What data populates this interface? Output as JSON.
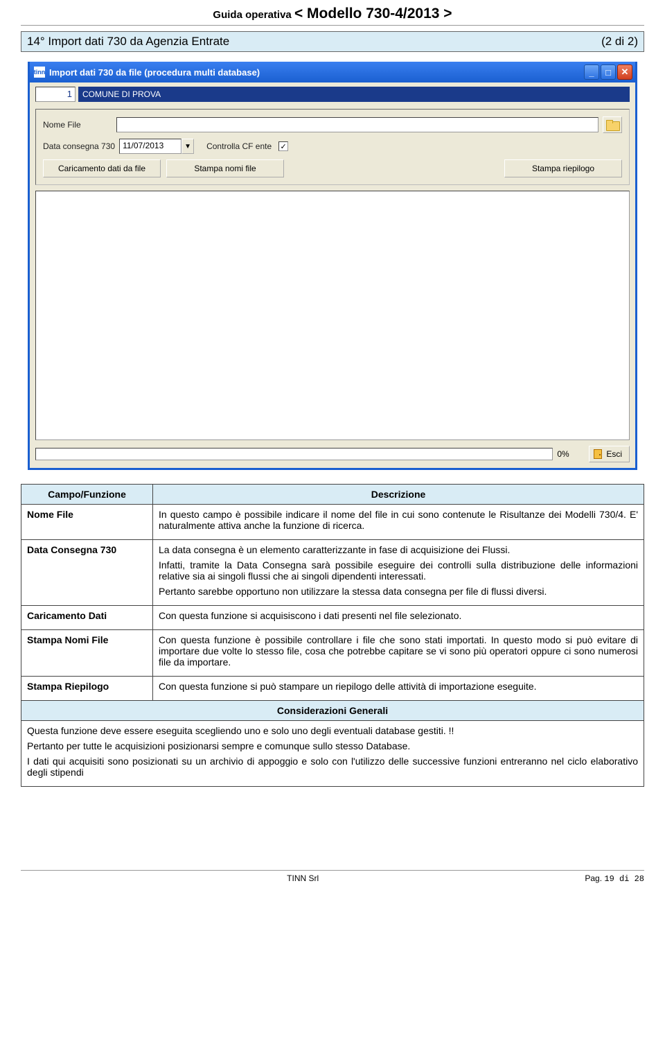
{
  "header": {
    "small": "Guida operativa   ",
    "big": "< Modello 730-4/2013 >"
  },
  "section": {
    "title": "14° Import dati 730 da Agenzia Entrate",
    "pager": "(2 di 2)"
  },
  "window": {
    "title": "Import dati 730 da file (procedura multi database)",
    "app_icon": "tinn",
    "id_value": "1",
    "id_name": "COMUNE DI PROVA",
    "nome_file_label": "Nome File",
    "nome_file_value": "",
    "data_consegna_label": "Data consegna 730",
    "data_consegna_value": "11/07/2013",
    "cf_label": "Controlla CF ente",
    "cf_checked": "✓",
    "btn_caricamento": "Caricamento dati da file",
    "btn_stampa_nomi": "Stampa nomi file",
    "btn_stampa_riepilogo": "Stampa riepilogo",
    "progress_pct": "0%",
    "btn_esci": "Esci"
  },
  "table": {
    "h1": "Campo/Funzione",
    "h2": "Descrizione",
    "rows": [
      {
        "left": "Nome File",
        "right": "In questo campo è possibile indicare il nome del file in cui sono contenute le Risultanze dei Modelli 730/4. E' naturalmente attiva anche la funzione di ricerca."
      },
      {
        "left": "Data Consegna 730",
        "right1": "La data consegna è un elemento caratterizzante in fase di acquisizione dei Flussi.",
        "right2": "Infatti, tramite la Data Consegna sarà possibile eseguire dei controlli sulla distribuzione delle informazioni relative sia ai singoli flussi che ai singoli dipendenti interessati.",
        "right3": "Pertanto sarebbe opportuno non utilizzare la stessa data consegna per file di flussi diversi."
      },
      {
        "left": "Caricamento Dati",
        "right": "Con questa funzione si acquisiscono i dati presenti nel file selezionato."
      },
      {
        "left": "Stampa Nomi File",
        "right": "Con questa funzione è possibile controllare i file che sono stati importati. In questo modo si può evitare di importare due volte lo stesso file, cosa che potrebbe capitare se vi sono più operatori oppure ci sono numerosi file da importare."
      },
      {
        "left": "Stampa Riepilogo",
        "right": "Con questa funzione si può stampare un riepilogo delle attività di importazione eseguite."
      }
    ],
    "cg_header": "Considerazioni Generali",
    "cg1": "Questa funzione deve essere eseguita scegliendo uno e solo uno degli eventuali database gestiti. !!",
    "cg2": "Pertanto per tutte le acquisizioni posizionarsi sempre e comunque sullo stesso Database.",
    "cg3": "I dati qui acquisiti sono posizionati su un archivio di appoggio e solo con l'utilizzo delle successive funzioni entreranno nel ciclo elaborativo degli stipendi"
  },
  "footer": {
    "left": "TINN Srl",
    "right_l": "Pag. ",
    "right_n": "19 di 28"
  }
}
